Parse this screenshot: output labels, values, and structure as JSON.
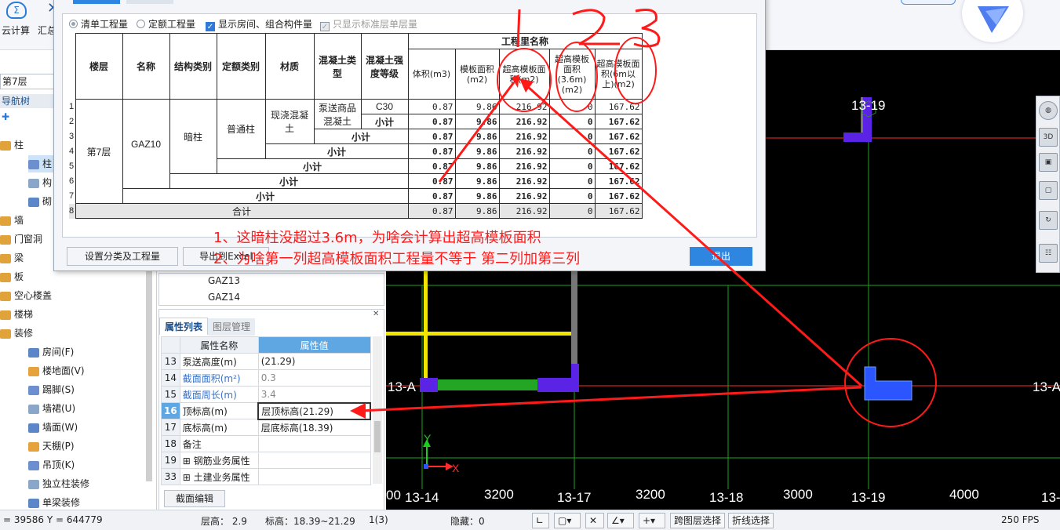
{
  "topbar": {
    "cloud_calc": "云计算",
    "summary": "汇总"
  },
  "left": {
    "floor": "第7层",
    "nav_title": "导航树",
    "tree": [
      {
        "label": "柱",
        "level": 0
      },
      {
        "label": "柱",
        "level": 1,
        "selected": true
      },
      {
        "label": "构",
        "level": 1
      },
      {
        "label": "砌",
        "level": 1
      },
      {
        "label": "墙",
        "level": 0
      },
      {
        "label": "门窗洞",
        "level": 0
      },
      {
        "label": "梁",
        "level": 0
      },
      {
        "label": "板",
        "level": 0
      },
      {
        "label": "空心楼盖",
        "level": 0
      },
      {
        "label": "楼梯",
        "level": 0
      },
      {
        "label": "装修",
        "level": 0
      },
      {
        "label": "房间(F)",
        "level": 1
      },
      {
        "label": "楼地面(V)",
        "level": 1
      },
      {
        "label": "踢脚(S)",
        "level": 1
      },
      {
        "label": "墙裙(U)",
        "level": 1
      },
      {
        "label": "墙面(W)",
        "level": 1
      },
      {
        "label": "天棚(P)",
        "level": 1
      },
      {
        "label": "吊顶(K)",
        "level": 1
      },
      {
        "label": "独立柱装修",
        "level": 1
      },
      {
        "label": "单梁装修",
        "level": 1
      }
    ]
  },
  "complist": [
    "GAZ13",
    "GAZ14"
  ],
  "props": {
    "tab_active": "属性列表",
    "tab_inactive": "图层管理",
    "col_name": "属性名称",
    "col_value": "属性值",
    "rows": [
      {
        "num": "13",
        "name": "泵送高度(m)",
        "value": "(21.29)",
        "style": ""
      },
      {
        "num": "14",
        "name": "截面面积(m²)",
        "value": "0.3",
        "style": "blue"
      },
      {
        "num": "15",
        "name": "截面周长(m)",
        "value": "3.4",
        "style": "blue"
      },
      {
        "num": "16",
        "name": "顶标高(m)",
        "value": "层顶标高(21.29)",
        "style": "sel"
      },
      {
        "num": "17",
        "name": "底标高(m)",
        "value": "层底标高(18.39)",
        "style": ""
      },
      {
        "num": "18",
        "name": "备注",
        "value": "",
        "style": ""
      },
      {
        "num": "19",
        "name": "钢筋业务属性",
        "value": "",
        "style": "plus"
      },
      {
        "num": "33",
        "name": "土建业务属性",
        "value": "",
        "style": "plus"
      }
    ],
    "edit_button": "截面编辑"
  },
  "dialog": {
    "options": {
      "bill": "清单工程量",
      "quota": "定额工程量",
      "show_room": "显示房间、组合构件量",
      "std_floor": "只显示标准层单层量"
    },
    "headers": {
      "floor": "楼层",
      "name": "名称",
      "struct": "结构类别",
      "quota": "定额类别",
      "material": "材质",
      "concrete_type": "混凝土类型",
      "concrete_grade": "混凝土强度等级",
      "qty_group": "工程里名称",
      "volume": "体积(m3)",
      "formwork": "模板面积(m2)",
      "hf": "超高模板面积(m2)",
      "hf36": "超高模板面积(3.6m)(m2)",
      "hf6": "超高模板面积(6m以上)(m2)"
    },
    "row_numbers": [
      "1",
      "2",
      "3",
      "4",
      "5",
      "6",
      "7",
      "8"
    ],
    "cells": {
      "floor": "第7层",
      "name": "GAZ10",
      "struct": "暗柱",
      "quota": "普通柱",
      "material": "现浇混凝土",
      "concrete_type": "泵送商品混凝土",
      "grade": "C30",
      "subtotal": "小计",
      "total": "合计"
    },
    "values": {
      "volume": "0.87",
      "formwork": "9.86",
      "hf": "216.92",
      "hf36": "0",
      "hf6": "167.62"
    },
    "buttons": {
      "set_classify": "设置分类及工程量",
      "export": "导出到Excel",
      "exit": "退出"
    }
  },
  "canvas": {
    "labels": {
      "gridtop": "13-19",
      "leftA": "13-A",
      "rightA": "13-A",
      "b1": "00",
      "b2": "13-14",
      "b3": "3200",
      "b4": "13-17",
      "b5": "3200",
      "b6": "13-18",
      "b7": "3000",
      "b8": "13-19",
      "b9": "4000",
      "b10": "13-"
    },
    "axis_y": "Y",
    "axis_x": "X"
  },
  "annotations": {
    "note1": "1、这暗柱没超过3.6m，为啥会计算出超高模板面积",
    "note2": "2、为啥第一列超高模板面积工程量不等于 第二列加第三列"
  },
  "statusbar": {
    "coords": "= 39586 Y = 644779",
    "floor_height": "层高： 2.9",
    "elevation": "标高：18.39~21.29",
    "count": "1(3)",
    "hidden": "隐藏：0",
    "cross_floor": "跨图层选择",
    "polyline": "折线选择",
    "fps": "250 FPS"
  }
}
